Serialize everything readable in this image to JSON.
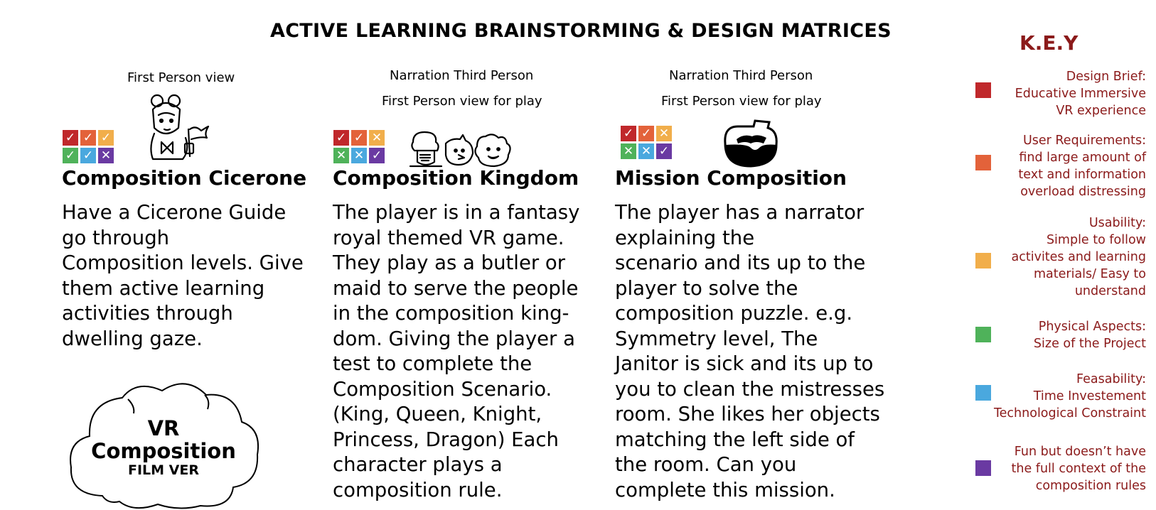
{
  "title": "ACTIVE LEARNING BRAINSTORMING & DESIGN MATRICES",
  "colors": {
    "red": "#c0282b",
    "orange": "#e3623a",
    "yellow": "#f1ae4b",
    "green": "#4fb25a",
    "blue": "#4aa8de",
    "purple": "#6a3aa2",
    "key_text": "#8b1a1a"
  },
  "cards": [
    {
      "view_lines": [
        "First Person view"
      ],
      "marks": [
        "check",
        "check",
        "check",
        "check",
        "check",
        "cross"
      ],
      "illustration": "guide-with-flag-icon",
      "title": "Composition Cicerone",
      "body": "Have a Cicerone Guide\ngo through\nComposition levels. Give\nthem active learning\nactivities through\ndwelling gaze.",
      "cloud": {
        "line1": "VR",
        "line2": "Composition",
        "line3": "FILM VER"
      }
    },
    {
      "view_lines": [
        "Narration Third Person",
        "First Person view for play"
      ],
      "marks": [
        "check",
        "check",
        "cross",
        "cross",
        "cross",
        "check"
      ],
      "illustration": "royal-characters-icon",
      "title": "Composition Kingdom",
      "body": "The player is in a fantasy\nroyal themed VR game.\nThey play as a butler or\nmaid to serve the people\nin the composition king-\ndom. Giving the player a\ntest to complete the\nComposition Scenario.\n(King, Queen, Knight,\nPrincess, Dragon) Each\ncharacter plays a\ncomposition rule."
    },
    {
      "view_lines": [
        "Narration Third Person",
        "First Person view for play"
      ],
      "marks": [
        "check",
        "check",
        "cross",
        "cross",
        "cross",
        "check"
      ],
      "illustration": "vr-headset-icon",
      "title": "Mission Composition",
      "body": "The player has a narrator\nexplaining the\nscenario and its up to the\nplayer to solve the\ncomposition puzzle. e.g.\nSymmetry level, The\nJanitor is sick and its up to\nyou to clean the mistresses\nroom. She likes her objects\nmatching  the left side of\nthe room. Can you\ncomplete this mission."
    }
  ],
  "key": {
    "title": "K.E.Y",
    "items": [
      {
        "color": "#c0282b",
        "text": "Design Brief:\nEducative Immersive\nVR experience"
      },
      {
        "color": "#e3623a",
        "text": "User Requirements:\nfind large amount of\ntext and information\noverload distressing"
      },
      {
        "color": "#f1ae4b",
        "text": "Usability:\nSimple to follow\nactivites and learning\nmaterials/ Easy to\nunderstand"
      },
      {
        "color": "#4fb25a",
        "text": "Physical Aspects:\nSize of the Project"
      },
      {
        "color": "#4aa8de",
        "text": "Feasability:\nTime Investement\nTechnological Constraint"
      },
      {
        "color": "#6a3aa2",
        "text": "Fun but doesn’t have\nthe full context of the\ncomposition rules"
      }
    ]
  }
}
